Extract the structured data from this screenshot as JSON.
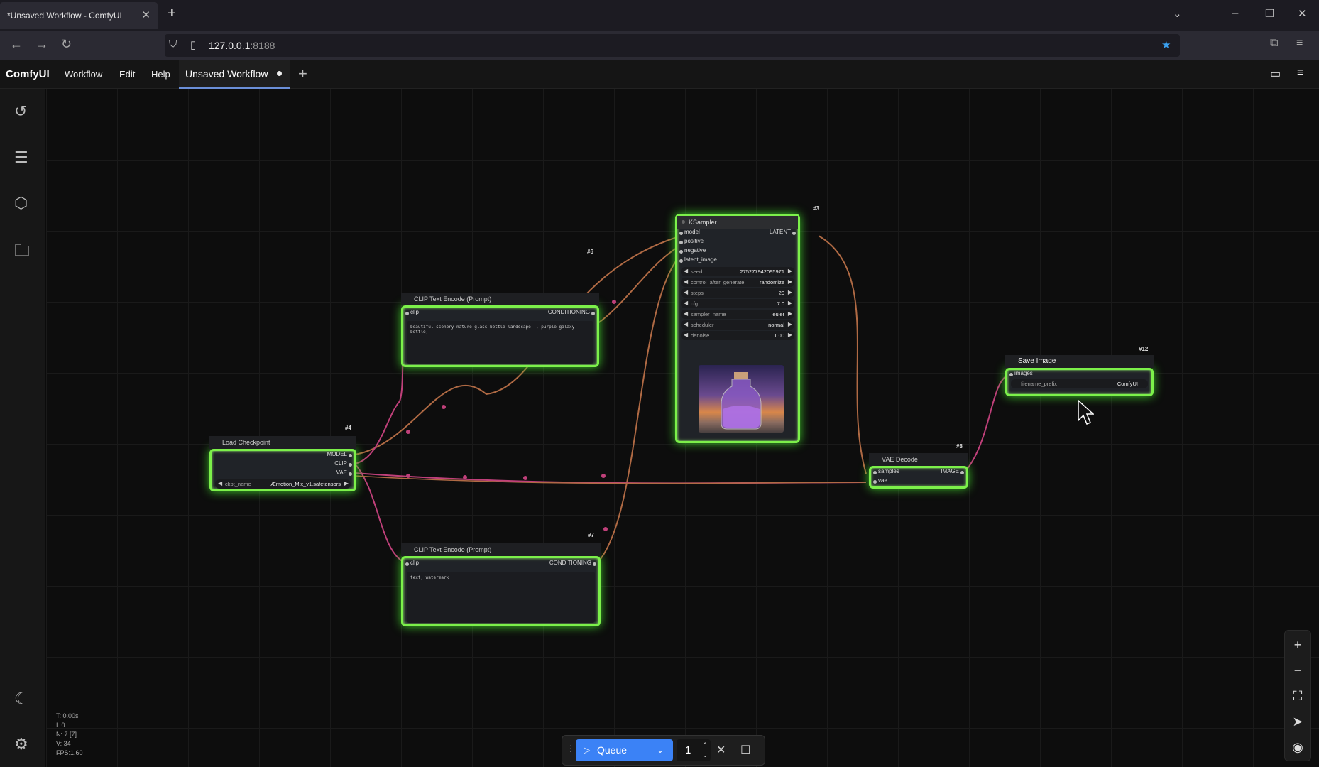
{
  "browser": {
    "tab_title": "*Unsaved Workflow - ComfyUI",
    "url_host": "127.0.0.1",
    "url_port": ":8188"
  },
  "menu": {
    "brand": "ComfyUI",
    "items": [
      "Workflow",
      "Edit",
      "Help"
    ],
    "workflow_tab": "Unsaved Workflow"
  },
  "nodes": {
    "ksampler": {
      "id": "#3",
      "title": "KSampler",
      "inputs": [
        "model",
        "positive",
        "negative",
        "latent_image"
      ],
      "output": "LATENT",
      "widgets": [
        {
          "label": "seed",
          "value": "275277942095971"
        },
        {
          "label": "control_after_generate",
          "value": "randomize"
        },
        {
          "label": "steps",
          "value": "20"
        },
        {
          "label": "cfg",
          "value": "7.0"
        },
        {
          "label": "sampler_name",
          "value": "euler"
        },
        {
          "label": "scheduler",
          "value": "normal"
        },
        {
          "label": "denoise",
          "value": "1.00"
        }
      ]
    },
    "clip_pos": {
      "id": "#6",
      "title": "CLIP Text Encode (Prompt)",
      "input": "clip",
      "output": "CONDITIONING",
      "text": "beautiful scenery nature glass bottle landscape, , purple galaxy bottle,"
    },
    "clip_neg": {
      "id": "#7",
      "title": "CLIP Text Encode (Prompt)",
      "input": "clip",
      "output": "CONDITIONING",
      "text": "text, watermark"
    },
    "checkpoint": {
      "id": "#4",
      "title": "Load Checkpoint",
      "outputs": [
        "MODEL",
        "CLIP",
        "VAE"
      ],
      "widget_label": "ckpt_name",
      "widget_value": "Æmotion_Mix_v1.safetensors"
    },
    "vae": {
      "id": "#8",
      "title": "VAE Decode",
      "inputs": [
        "samples",
        "vae"
      ],
      "output": "IMAGE"
    },
    "save": {
      "id": "#12",
      "title": "Save Image",
      "input": "images",
      "widget_label": "filename_prefix",
      "widget_value": "ComfyUI"
    }
  },
  "stats": [
    "T: 0.00s",
    "I: 0",
    "N: 7 [7]",
    "V: 34",
    "FPS:1.60"
  ],
  "queue": {
    "label": "Queue",
    "count": "1"
  },
  "colors": {
    "node_glow": "#7cf04a",
    "queue_button": "#3b82f6",
    "link_model": "#b06a44",
    "link_clip": "#c0407a"
  }
}
